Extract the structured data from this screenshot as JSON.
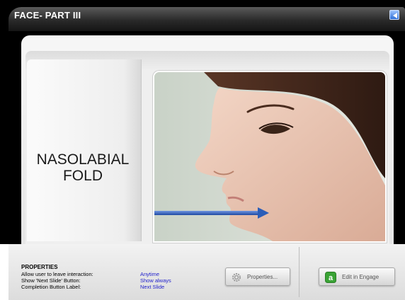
{
  "player": {
    "title": "FACE- PART III"
  },
  "slide": {
    "label_line1": "NASOLABIAL",
    "label_line2": "FOLD"
  },
  "properties": {
    "heading": "PROPERTIES",
    "rows": [
      {
        "label": "Allow user to leave interaction:",
        "value": "Anytime"
      },
      {
        "label": "Show 'Next Slide' Button:",
        "value": "Show always"
      },
      {
        "label": "Completion Button Label:",
        "value": "Next Slide"
      }
    ],
    "properties_button": "Properties...",
    "edit_button": "Edit in Engage"
  },
  "colors": {
    "value_text": "#2222cc",
    "arrow": "#2a5db8",
    "engage_icon": "#3aa335"
  },
  "icons": {
    "nav": "back-arrow-icon",
    "properties": "gear-icon",
    "edit": "engage-logo-icon"
  }
}
